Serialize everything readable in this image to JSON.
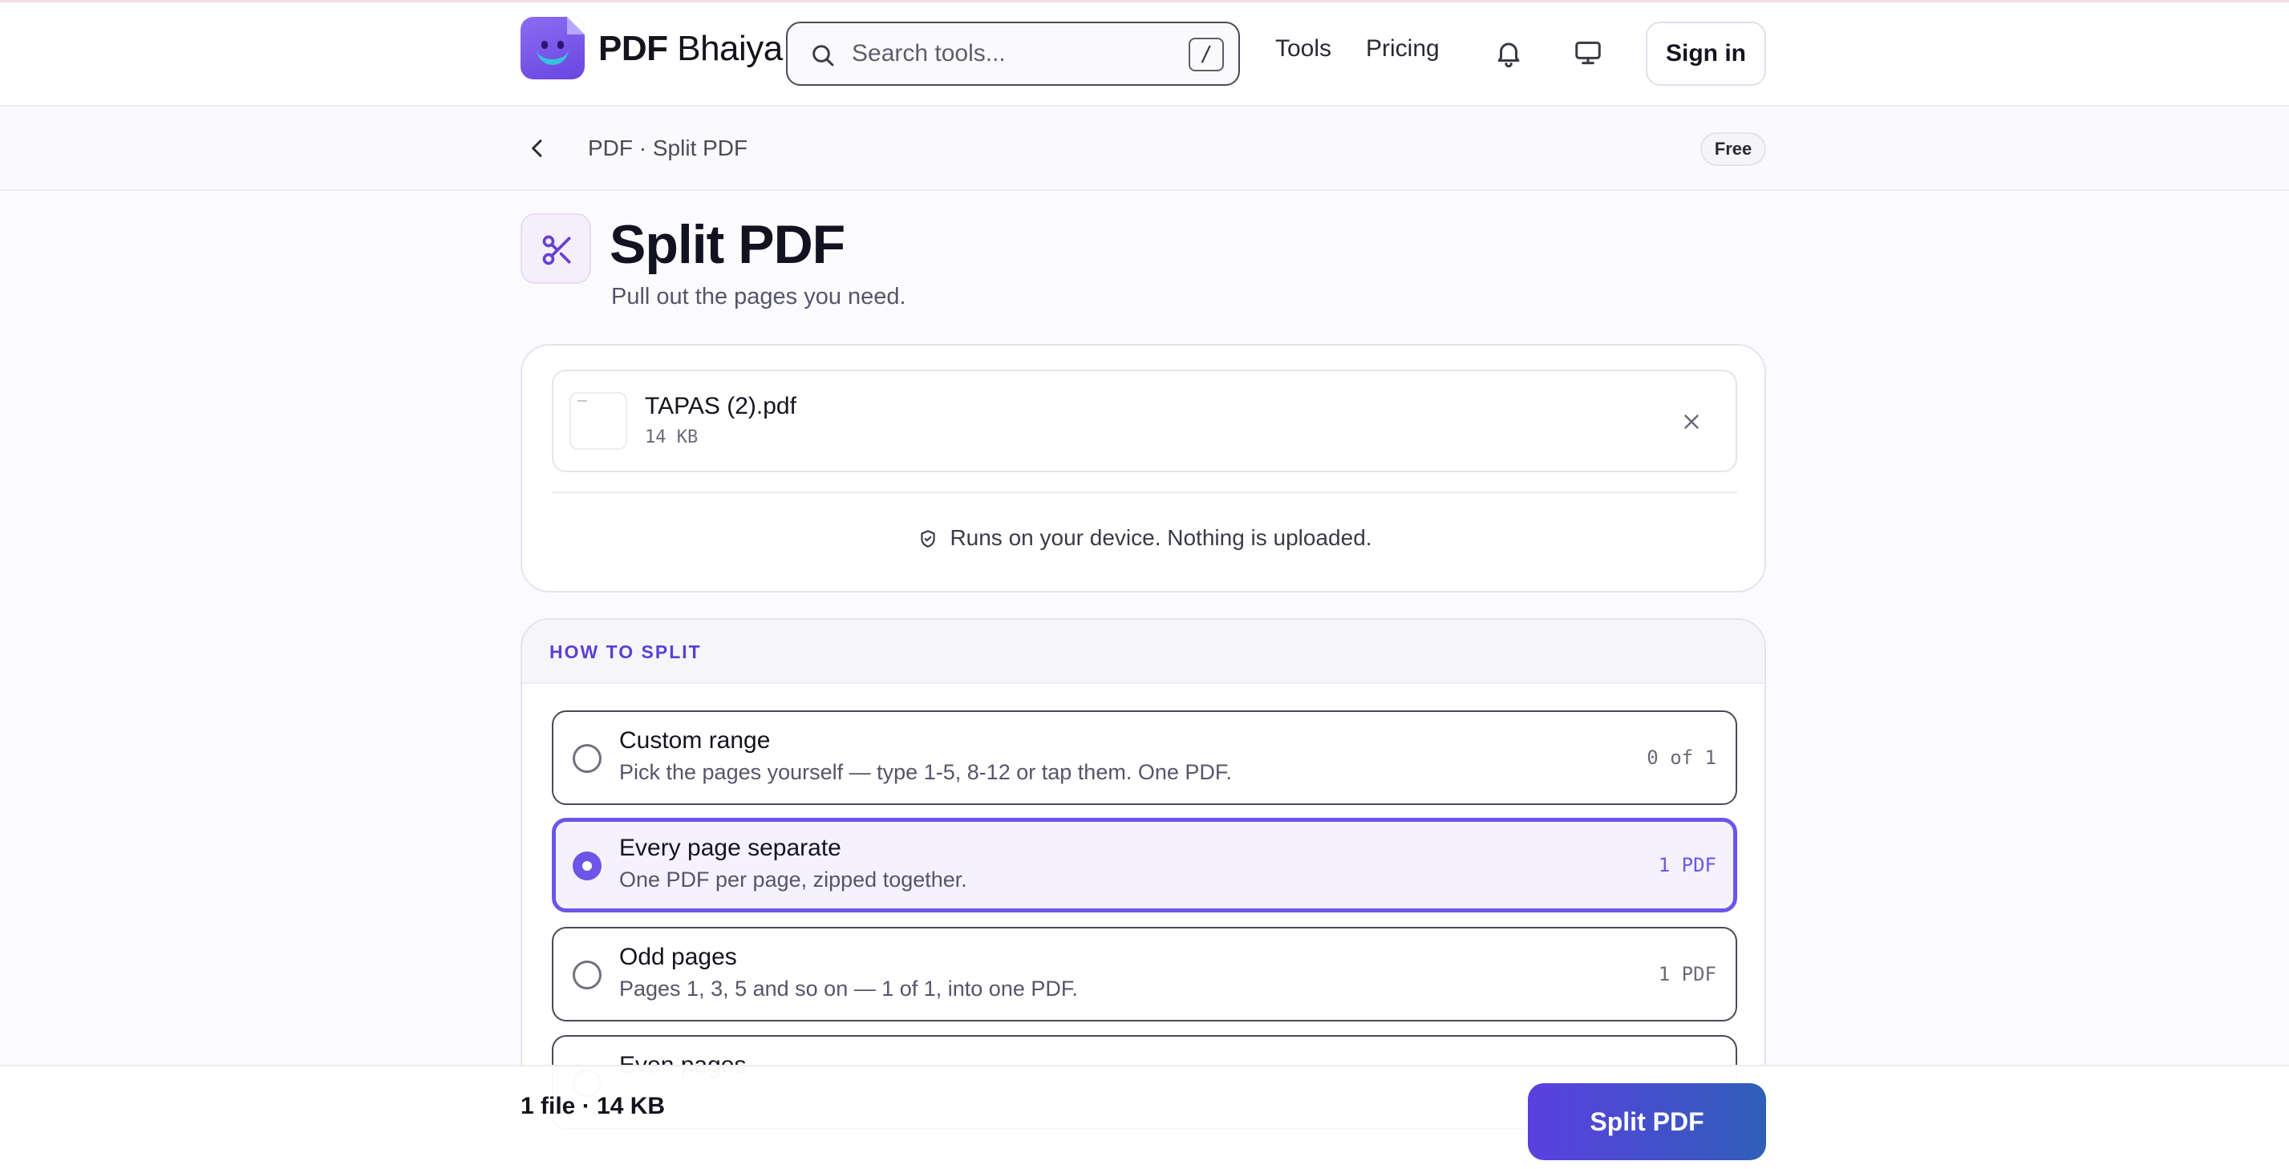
{
  "header": {
    "brand_bold": "PDF",
    "brand_rest": "Bhaiya",
    "search": {
      "placeholder": "Search tools...",
      "shortcut": "/"
    },
    "nav": {
      "tools": "Tools",
      "pricing": "Pricing"
    },
    "sign_in": "Sign in",
    "icons": [
      "search-icon",
      "bell-icon",
      "monitor-icon"
    ]
  },
  "breadcrumb": {
    "path": "PDF · Split PDF",
    "badge": "Free"
  },
  "page": {
    "title": "Split PDF",
    "subtitle": "Pull out the pages you need.",
    "icon": "scissors-icon"
  },
  "file": {
    "name": "TAPAS (2).pdf",
    "size": "14 KB"
  },
  "privacy_note": "Runs on your device. Nothing is uploaded.",
  "split": {
    "heading": "HOW TO SPLIT",
    "selected": "every_page",
    "options": [
      {
        "id": "custom",
        "title": "Custom range",
        "description": "Pick the pages yourself — type 1-5, 8-12 or tap them. One PDF.",
        "count": "0 of 1"
      },
      {
        "id": "every_page",
        "title": "Every page separate",
        "description": "One PDF per page, zipped together.",
        "count": "1 PDF"
      },
      {
        "id": "odd",
        "title": "Odd pages",
        "description": "Pages 1, 3, 5 and so on — 1 of 1, into one PDF.",
        "count": "1 PDF"
      },
      {
        "id": "even",
        "title": "Even pages",
        "description": "",
        "count": ""
      }
    ]
  },
  "footer": {
    "summary": "1 file · 14 KB",
    "action": "Split PDF"
  },
  "colors": {
    "accent": "#6d55e8",
    "brand_gradient_start": "#5a3fe0",
    "brand_gradient_end": "#2f5fb8"
  }
}
